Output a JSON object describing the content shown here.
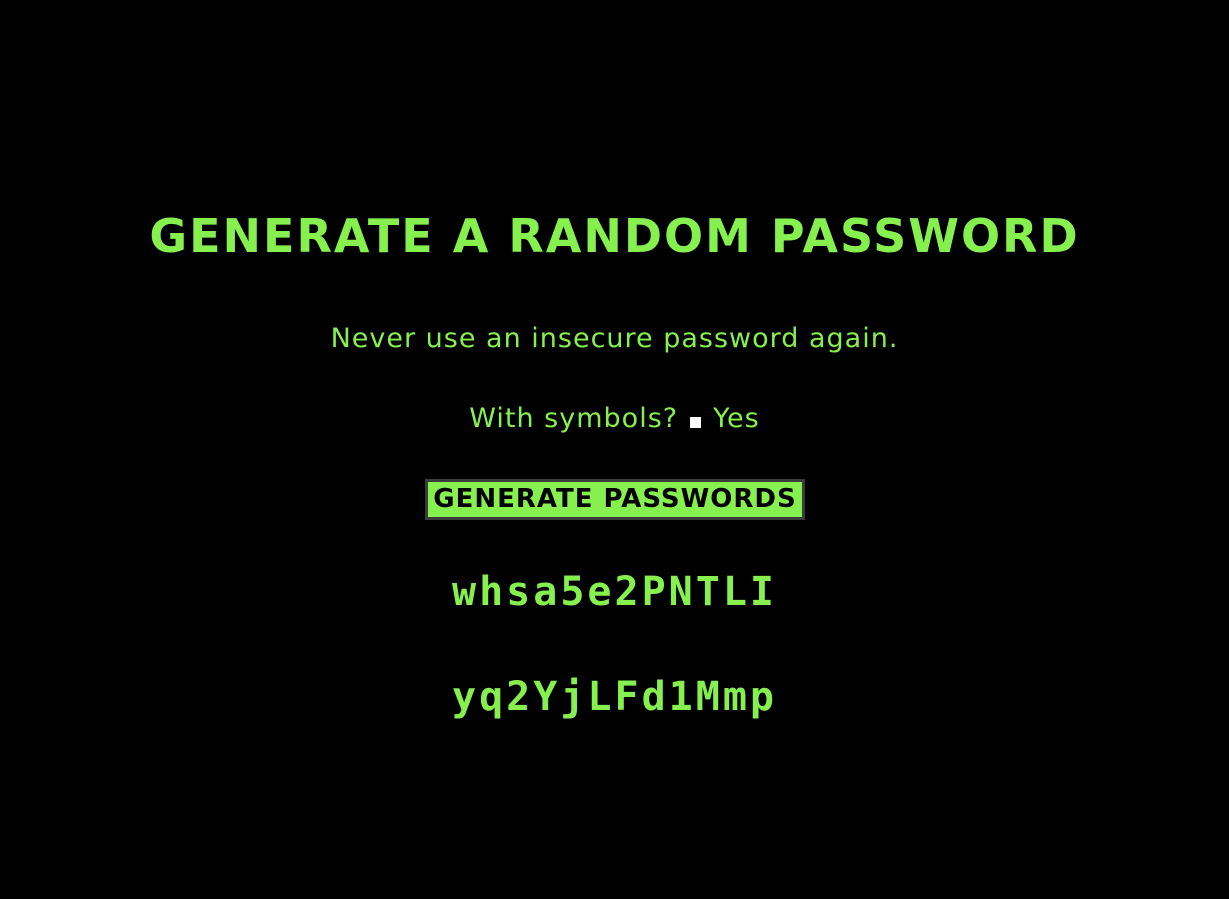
{
  "header": {
    "title": "Generate a random password",
    "subtitle": "Never use an insecure password again."
  },
  "options": {
    "symbols_label": "With symbols?",
    "symbols_value_label": "Yes",
    "symbols_checked": false
  },
  "actions": {
    "generate_label": "Generate Passwords"
  },
  "passwords": [
    "whsa5e2PNTLI",
    "yq2YjLFd1Mmp"
  ],
  "colors": {
    "background": "#000000",
    "accent": "#86f04f",
    "button_text": "#000000",
    "button_border": "#3b3b3b"
  }
}
